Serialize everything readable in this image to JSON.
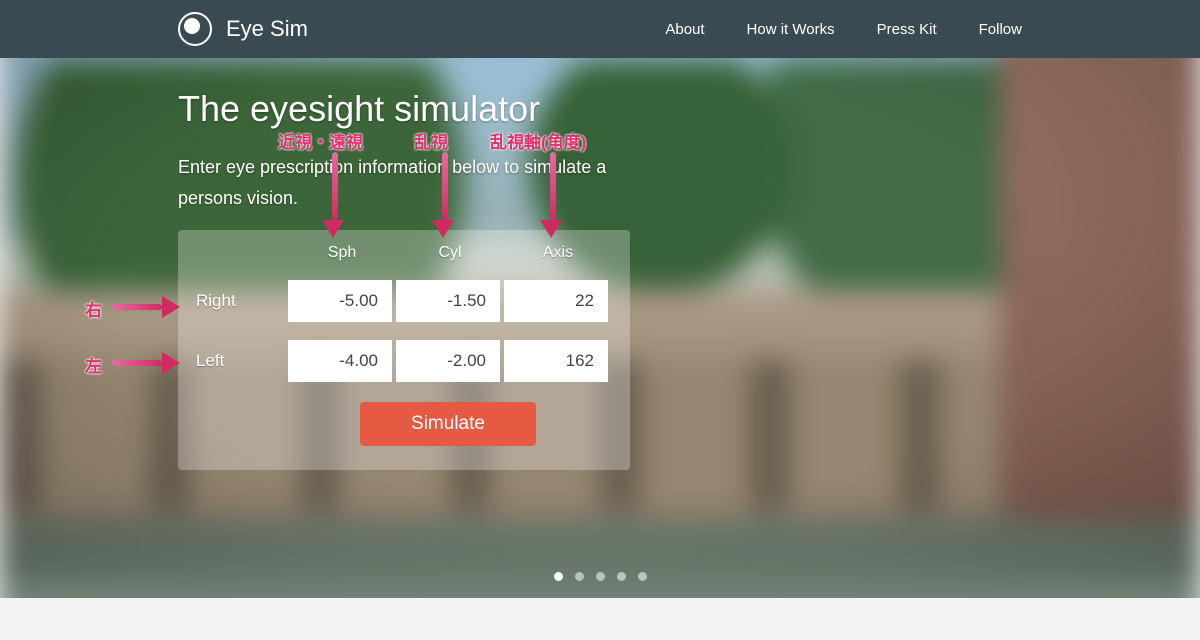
{
  "brand": "Eye Sim",
  "nav": {
    "about": "About",
    "how": "How it Works",
    "press": "Press Kit",
    "follow": "Follow"
  },
  "hero": {
    "title": "The eyesight simulator",
    "subtitle": "Enter eye prescription information below to simulate a persons vision."
  },
  "form": {
    "col_sph": "Sph",
    "col_cyl": "Cyl",
    "col_axis": "Axis",
    "row_right": "Right",
    "row_left": "Left",
    "right": {
      "sph": "-5.00",
      "cyl": "-1.50",
      "axis": "22"
    },
    "left": {
      "sph": "-4.00",
      "cyl": "-2.00",
      "axis": "162"
    },
    "simulate": "Simulate"
  },
  "annotations": {
    "sph": "近視・遠視",
    "cyl": "乱視",
    "axis": "乱視軸(角度)",
    "right": "右",
    "left": "左"
  },
  "carousel": {
    "count": 5,
    "active": 0
  }
}
